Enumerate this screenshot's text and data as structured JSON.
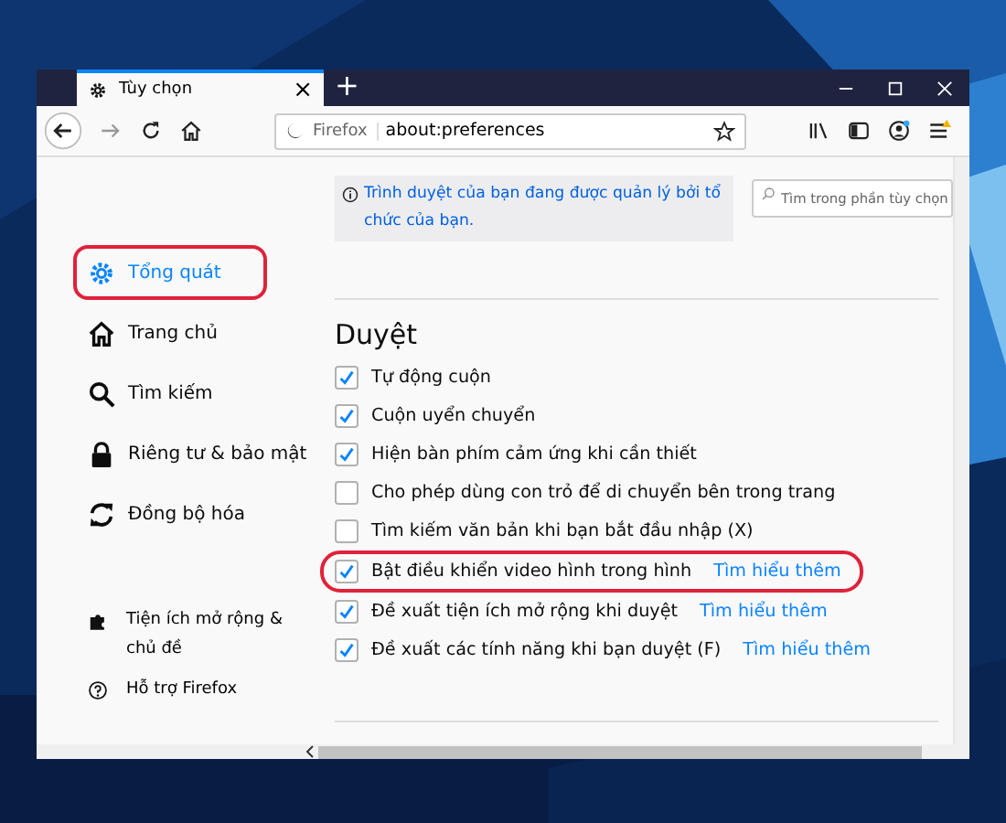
{
  "window": {
    "tab": {
      "title": "Tùy chọn",
      "close": "×"
    },
    "new_tab": "+"
  },
  "toolbar": {
    "identity": "Firefox",
    "url": "about:preferences"
  },
  "sidebar": {
    "items": [
      {
        "label": "Tổng quát",
        "kind": "gear",
        "selected": true,
        "circled": true
      },
      {
        "label": "Trang chủ",
        "kind": "home",
        "selected": false,
        "circled": false
      },
      {
        "label": "Tìm kiếm",
        "kind": "search",
        "selected": false,
        "circled": false
      },
      {
        "label": "Riêng tư & bảo mật",
        "kind": "lock",
        "selected": false,
        "circled": false
      },
      {
        "label": "Đồng bộ hóa",
        "kind": "sync",
        "selected": false,
        "circled": false
      }
    ],
    "footer": [
      {
        "label": "Tiện ích mở rộng & chủ đề",
        "kind": "puzzle"
      },
      {
        "label": "Hỗ trợ Firefox",
        "kind": "help"
      }
    ]
  },
  "notice": "Trình duyệt của bạn đang được quản lý bởi tổ chức của bạn.",
  "search": {
    "placeholder": "Tìm trong phần tùy chọn"
  },
  "section": {
    "title": "Duyệt",
    "options": [
      {
        "label": "Tự động cuộn",
        "checked": true,
        "circled": false
      },
      {
        "label": "Cuộn uyển chuyển",
        "checked": true,
        "circled": false
      },
      {
        "label": "Hiện bàn phím cảm ứng khi cần thiết",
        "checked": true,
        "circled": false
      },
      {
        "label": "Cho phép dùng con trỏ để di chuyển bên trong trang",
        "checked": false,
        "circled": false
      },
      {
        "label": "Tìm kiếm văn bản khi bạn bắt đầu nhập (X)",
        "checked": false,
        "circled": false
      },
      {
        "label": "Bật điều khiển video hình trong hình",
        "checked": true,
        "circled": true,
        "link": "Tìm hiểu thêm"
      },
      {
        "label": "Đề xuất tiện ích mở rộng khi duyệt",
        "checked": true,
        "circled": false,
        "link": "Tìm hiểu thêm"
      },
      {
        "label": "Đề xuất các tính năng khi bạn duyệt (F)",
        "checked": true,
        "circled": false,
        "link": "Tìm hiểu thêm"
      }
    ]
  }
}
